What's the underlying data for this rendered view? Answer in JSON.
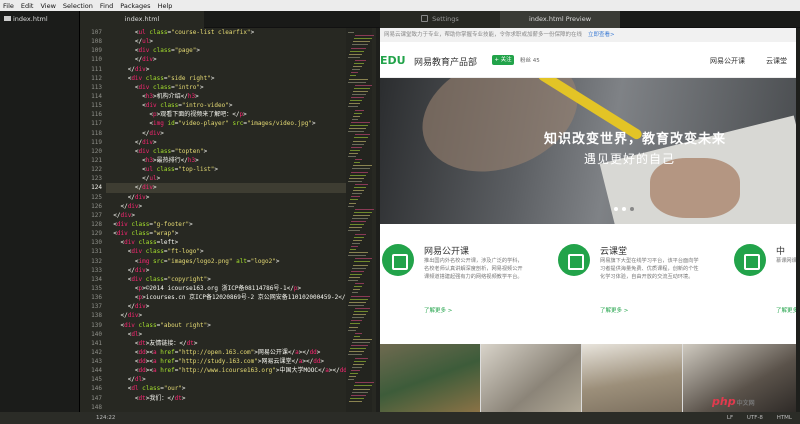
{
  "menu": [
    "File",
    "Edit",
    "View",
    "Selection",
    "Find",
    "Packages",
    "Help"
  ],
  "sidebar": {
    "file": "index.html"
  },
  "tabs": [
    {
      "label": "index.html"
    },
    {
      "label": "Settings"
    },
    {
      "label": "index.html Preview"
    }
  ],
  "editor": {
    "cursor_line": 124,
    "lines": [
      {
        "n": 107,
        "code": "        <ul class=\"course-list clearfix\">"
      },
      {
        "n": 108,
        "code": "        </ul>"
      },
      {
        "n": 109,
        "code": "        <div class=\"page\">"
      },
      {
        "n": 110,
        "code": "        </div>"
      },
      {
        "n": 111,
        "code": "      </div>"
      },
      {
        "n": 112,
        "code": "      <div class=\"side right\">"
      },
      {
        "n": 113,
        "code": "        <div class=\"intro\">"
      },
      {
        "n": 114,
        "code": "          <h3>机构介绍</h3>"
      },
      {
        "n": 115,
        "code": "          <div class=\"intro-video\">"
      },
      {
        "n": 116,
        "code": "            <p>观看下面的视频来了解吧：</p>"
      },
      {
        "n": 117,
        "code": "            <img id=\"video-player\" src=\"images/video.jpg\">"
      },
      {
        "n": 118,
        "code": "          </div>"
      },
      {
        "n": 119,
        "code": "        </div>"
      },
      {
        "n": 120,
        "code": "        <div class=\"topten\">"
      },
      {
        "n": 121,
        "code": "          <h3>最热排行</h3>"
      },
      {
        "n": 122,
        "code": "          <ul class=\"top-list\">"
      },
      {
        "n": 123,
        "code": "          </ul>"
      },
      {
        "n": 124,
        "code": "        </div>"
      },
      {
        "n": 125,
        "code": "      </div>"
      },
      {
        "n": 126,
        "code": "    </div>"
      },
      {
        "n": 127,
        "code": "  </div>"
      },
      {
        "n": 128,
        "code": "  <div class=\"g-footer\">"
      },
      {
        "n": 129,
        "code": "  <div class=\"wrap\">"
      },
      {
        "n": 130,
        "code": "    <div class=left>"
      },
      {
        "n": 131,
        "code": "      <div class=\"ft-logo\">"
      },
      {
        "n": 132,
        "code": "        <img src=\"images/logo2.png\" alt=\"logo2\">"
      },
      {
        "n": 133,
        "code": "      </div>"
      },
      {
        "n": 134,
        "code": "      <div class=\"copyright\">"
      },
      {
        "n": 135,
        "code": "        <p>©2014 icourse163.org 浙ICP备08114786号-1</p>"
      },
      {
        "n": 136,
        "code": "        <p>icourses.cn 京ICP备12020869号-2 京公网安备110102000459-2</p>"
      },
      {
        "n": 137,
        "code": "      </div>"
      },
      {
        "n": 138,
        "code": "    </div>"
      },
      {
        "n": 139,
        "code": "    <div class=\"about right\">"
      },
      {
        "n": 140,
        "code": "      <dl>"
      },
      {
        "n": 141,
        "code": "        <dt>友情链接：</dt>"
      },
      {
        "n": 142,
        "code": "        <dd><a href=\"http://open.163.com\">网易公开课</a></dd>"
      },
      {
        "n": 143,
        "code": "        <dd><a href=\"http://study.163.com\">网易云课堂</a></dd>"
      },
      {
        "n": 144,
        "code": "        <dd><a href=\"http://www.icourse163.org\">中国大学MOOC</a></dd>"
      },
      {
        "n": 145,
        "code": "      </dl>"
      },
      {
        "n": 146,
        "code": "      <dl class=\"our\">"
      },
      {
        "n": 147,
        "code": "        <dt>我们：</dt>"
      },
      {
        "n": 148,
        "code": ""
      }
    ]
  },
  "status": {
    "cursor": "124:22",
    "line_ending": "LF",
    "encoding": "UTF-8",
    "grammar": "HTML"
  },
  "preview": {
    "promo_text": "网易云课堂致力于专业，帮助你掌握专业技能，令你求职或加薪多一份保障的在线",
    "promo_link": "立即查看>",
    "logo": "EDU",
    "logo_sub": "网易教育产品部",
    "follow": "+ 关注",
    "fans": "粉丝 45",
    "nav": [
      "网易公开课",
      "云课堂"
    ],
    "slogan1": "知识改变世界，教育改变未来",
    "slogan2": "遇见更好的自己",
    "features": [
      {
        "title": "网易公开课",
        "desc": "推出国内外名校公开课，涉及广泛的学科，名校老师认真讲解深度剖析，网易视频公开课频道搭建起强有力的网络视频教学平台。",
        "more": "了解更多 >"
      },
      {
        "title": "云课堂",
        "desc": "网易旗下大型在线学习平台，该平台面向学习者提供海量免费、优质课程，创新的个性化学习体验，自由开放的交流互动环境。",
        "more": "了解更多 >"
      },
      {
        "title": "中",
        "desc": "慕课网课程让提供和能",
        "more": "了解更多 >"
      }
    ]
  },
  "colors": {
    "accent": "#22a34a",
    "editor_bg": "#272822",
    "tag": "#f92672",
    "attr": "#a6e22e",
    "string": "#e6db74"
  },
  "watermark": {
    "brand": "php",
    "sub": "中文网"
  }
}
